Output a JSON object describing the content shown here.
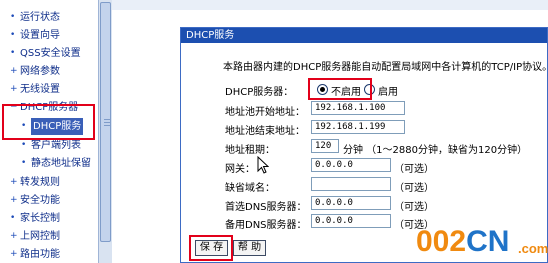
{
  "sidebar": {
    "items": [
      {
        "label": "运行状态",
        "bullet": "•"
      },
      {
        "label": "设置向导",
        "bullet": "•"
      },
      {
        "label": "QSS安全设置",
        "bullet": "•"
      },
      {
        "label": "网络参数",
        "bullet": "+"
      },
      {
        "label": "无线设置",
        "bullet": "+"
      },
      {
        "label": "DHCP服务器",
        "bullet": "−"
      },
      {
        "label": "DHCP服务",
        "bullet": "•"
      },
      {
        "label": "客户端列表",
        "bullet": "•"
      },
      {
        "label": "静态地址保留",
        "bullet": "•"
      },
      {
        "label": "转发规则",
        "bullet": "+"
      },
      {
        "label": "安全功能",
        "bullet": "+"
      },
      {
        "label": "家长控制",
        "bullet": "•"
      },
      {
        "label": "上网控制",
        "bullet": "+"
      },
      {
        "label": "路由功能",
        "bullet": "+"
      }
    ]
  },
  "panel": {
    "title": "DHCP服务",
    "description": "本路由器内建的DHCP服务器能自动配置局域网中各计算机的TCP/IP协议。"
  },
  "form": {
    "dhcp_server_label": "DHCP服务器：",
    "option_disable": "不启用",
    "option_enable": "启用",
    "selected_option": "不启用",
    "pool_start_label": "地址池开始地址：",
    "pool_start_value": "192.168.1.100",
    "pool_end_label": "地址池结束地址：",
    "pool_end_value": "192.168.1.199",
    "lease_label": "地址租期：",
    "lease_value": "120",
    "lease_hint": "分钟 （1～2880分钟，缺省为120分钟）",
    "gateway_label": "网关：",
    "gateway_value": "0.0.0.0",
    "optional": "（可选）",
    "domain_label": "缺省域名：",
    "domain_value": "",
    "dns1_label": "首选DNS服务器：",
    "dns1_value": "0.0.0.0",
    "dns2_label": "备用DNS服务器：",
    "dns2_value": "0.0.0.0"
  },
  "buttons": {
    "save": "保 存",
    "help": "帮 助"
  },
  "watermark": {
    "text_orange": "002",
    "text_blue": "CN",
    "suffix": ".com"
  },
  "colors": {
    "panel_header": "#1c4fb0",
    "sidebar_text": "#0f2e8a",
    "highlight_box": "#e2001a",
    "watermark_orange": "#f08a10",
    "watermark_blue": "#1f73c8"
  }
}
